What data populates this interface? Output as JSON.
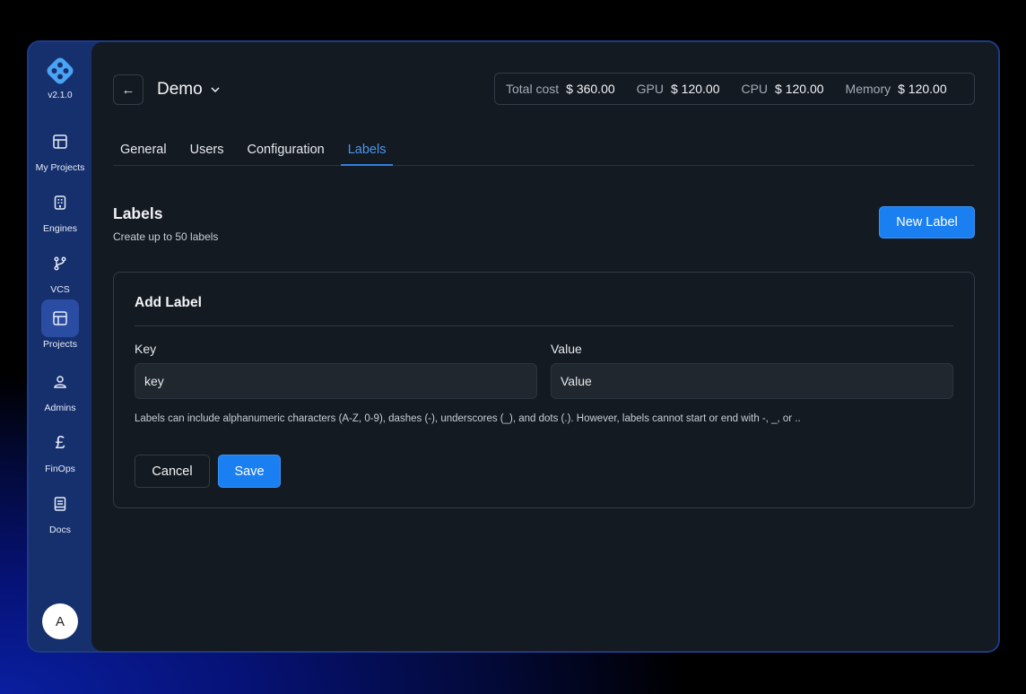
{
  "app": {
    "version": "v2.1.0",
    "avatar_initial": "A"
  },
  "sidebar": {
    "items": [
      {
        "label": "My Projects",
        "icon": "layout-icon"
      },
      {
        "label": "Engines",
        "icon": "engine-icon"
      },
      {
        "label": "VCS",
        "icon": "git-branch-icon"
      },
      {
        "label": "Projects",
        "icon": "layout-icon",
        "active": true
      },
      {
        "label": "Admins",
        "icon": "admin-user-icon"
      },
      {
        "label": "FinOps",
        "icon": "pound-icon"
      },
      {
        "label": "Docs",
        "icon": "book-icon"
      }
    ]
  },
  "header": {
    "project_name": "Demo",
    "costs": [
      {
        "label": "Total cost",
        "value": "$ 360.00"
      },
      {
        "label": "GPU",
        "value": "$ 120.00"
      },
      {
        "label": "CPU",
        "value": "$ 120.00"
      },
      {
        "label": "Memory",
        "value": "$ 120.00"
      }
    ]
  },
  "tabs": [
    {
      "label": "General"
    },
    {
      "label": "Users"
    },
    {
      "label": "Configuration"
    },
    {
      "label": "Labels",
      "active": true
    }
  ],
  "labels_section": {
    "title": "Labels",
    "subtitle": "Create up to 50 labels",
    "new_button": "New Label"
  },
  "add_label": {
    "title": "Add Label",
    "key_label": "Key",
    "key_value": "key",
    "value_label": "Value",
    "value_value": "Value",
    "hint": "Labels can include alphanumeric characters (A-Z, 0-9), dashes (-), underscores (_), and dots (.). However, labels cannot start or end with -, _, or ..",
    "cancel": "Cancel",
    "save": "Save"
  },
  "colors": {
    "accent": "#1a7ff0",
    "active_tab": "#4c95ee",
    "sidebar_bg": "#16306e",
    "main_bg": "#141a21"
  }
}
